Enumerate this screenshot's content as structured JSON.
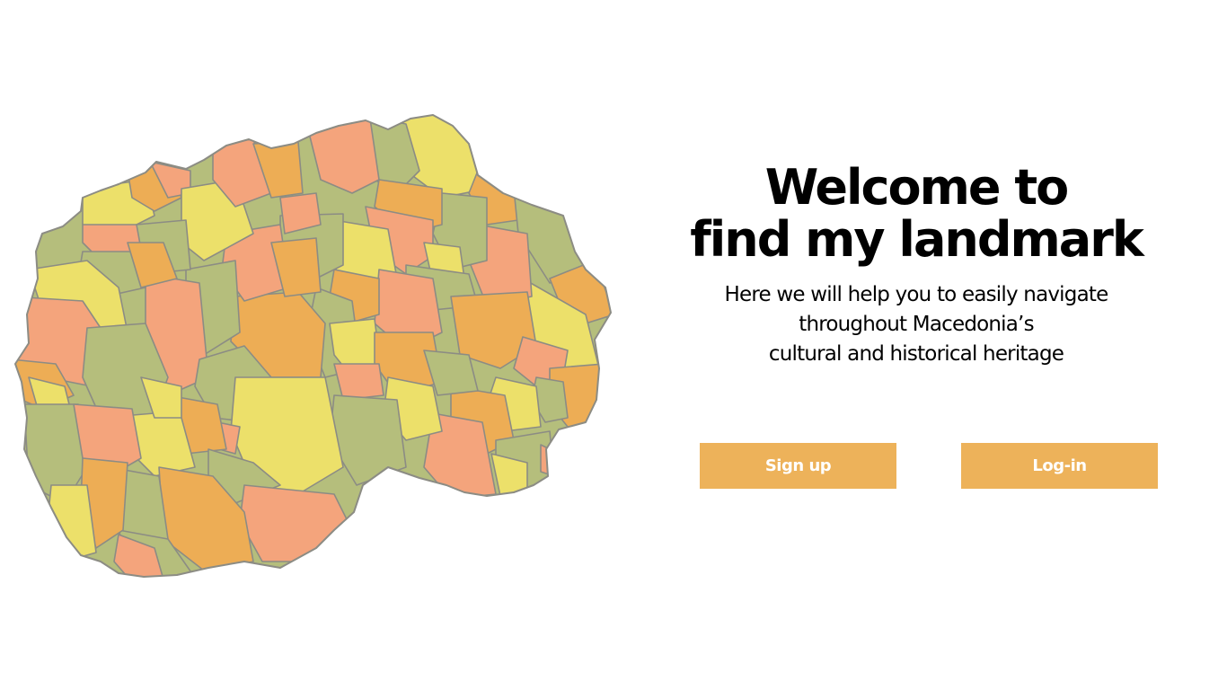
{
  "hero": {
    "title_line1": "Welcome to",
    "title_line2": "find my landmark",
    "subtitle_line1": "Here we will help you to easily navigate",
    "subtitle_line2": "throughout Macedonia’s",
    "subtitle_line3": "cultural and historical heritage"
  },
  "actions": {
    "signup_label": "Sign up",
    "login_label": "Log-in"
  },
  "colors": {
    "button": "#EDB25A",
    "map_green": "#B5BE7C",
    "map_yellow": "#ECE06A",
    "map_orange": "#EDAD55",
    "map_salmon": "#F4A47C",
    "map_border": "#8C8C84"
  }
}
